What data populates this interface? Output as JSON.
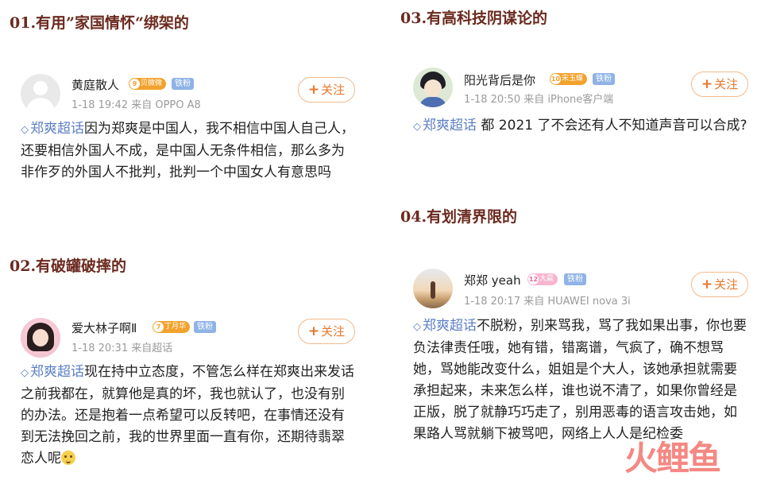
{
  "headings": {
    "h1": "01.有用”家国情怀“绑架的",
    "h2": "02.有破罐破摔的",
    "h3": "03.有高科技阴谋论的",
    "h4": "04.有划清界限的"
  },
  "posts": [
    {
      "username": "黄庭散人",
      "level_badge": "贝微微",
      "level": "9",
      "fan_badge": "铁粉",
      "meta": "1-18 19:42  来自 OPPO A8",
      "follow_label": "关注",
      "topic": "郑爽超话",
      "text": "因为郑爽是中国人，我不相信中国人自己人，还要相信外国人不成，是中国人无条件相信，那么多为非作歹的外国人不批判，批判一个中国女人有意思吗"
    },
    {
      "username": "爱大林子啊Ⅱ",
      "level_badge": "丁月华",
      "level": "7",
      "fan_badge": "铁粉",
      "meta": "1-18 20:31  来自超话",
      "follow_label": "关注",
      "topic": "郑爽超话",
      "text": "现在持中立态度，不管怎么样在郑爽出来发话之前我都在，就算他是真的坏，我也就认了，也没有别的办法。还是抱着一点希望可以反转吧，在事情还没有到无法挽回之前，我的世界里面一直有你，还期待翡翠恋人呢"
    },
    {
      "username": "阳光背后是你",
      "level_badge": "宋玉蝶",
      "level": "10",
      "fan_badge": "铁粉",
      "meta": "1-18 20:50  来自 iPhone客户端",
      "follow_label": "关注",
      "topic": "郑爽超话",
      "text": "都 2021 了不会还有人不知道声音可以合成?"
    },
    {
      "username": "郑郑 yeah",
      "level_badge": "大晨",
      "level": "12",
      "fan_badge": "铁粉",
      "meta": "1-18 20:17  来自 HUAWEI nova 3i",
      "follow_label": "关注",
      "topic": "郑爽超话",
      "text": "不脱粉，别来骂我，骂了我如果出事，你也要负法律责任哦，她有错，错离谱，气疯了，确不想骂她，骂她能改变什么，姐姐是个大人，该她承担就需要承担起来，未来怎么样，谁也说不清了，如果你曾经是正版，脱了就静巧巧走了，别用恶毒的语言攻击她，如果路人骂就躺下被骂吧，网络上人人是纪检委"
    }
  ],
  "watermark": "火鲤鱼",
  "colors": {
    "heading": "#6b2a1f",
    "topic": "#5b7fc4",
    "follow": "#e8772e",
    "badge": "#f2a22c",
    "fan": "#8fb3e6"
  },
  "icons": {
    "topic_icon": "diamond-icon",
    "emoji": "smile-emoji-icon"
  }
}
